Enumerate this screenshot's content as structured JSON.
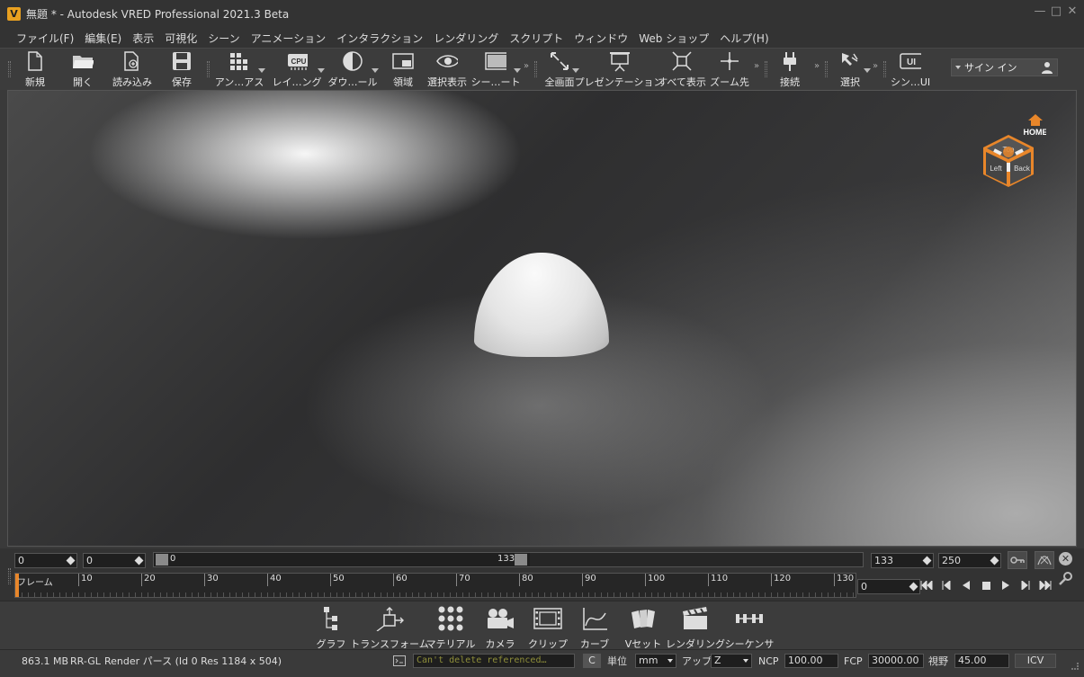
{
  "window": {
    "title": "無題 * - Autodesk VRED Professional 2021.3 Beta",
    "logo_letter": "V"
  },
  "menu": [
    "ファイル(F)",
    "編集(E)",
    "表示",
    "可視化",
    "シーン",
    "アニメーション",
    "インタラクション",
    "レンダリング",
    "スクリプト",
    "ウィンドウ",
    "Web ショップ",
    "ヘルプ(H)"
  ],
  "toolbar": {
    "new": "新規",
    "open": "開く",
    "import": "読み込み",
    "save": "保存",
    "antialias": "アン…アス",
    "raytracing": "レイ…ング",
    "download": "ダウ…ール",
    "region": "領域",
    "show_selected": "選択表示",
    "scene_plate": "シー…ート",
    "fullscreen": "全画面",
    "presentation": "プレゼンテーション",
    "show_all": "すべて表示",
    "zoom_to": "ズーム先",
    "connect": "接続",
    "select": "選択",
    "scene_ui": "シン…UI",
    "signin": "サイン イン",
    "cpu_badge": "CPU",
    "ui_badge": "UI"
  },
  "navcube": {
    "home": "HOME",
    "top": "Top",
    "left": "Left",
    "back": "Back"
  },
  "timeline": {
    "start": "0",
    "current": "0",
    "range_start": "0",
    "range_end": "133",
    "end_frame": "133",
    "total": "250",
    "frame_label": "フレーム",
    "ticks": [
      "10",
      "20",
      "30",
      "40",
      "50",
      "60",
      "70",
      "80",
      "90",
      "100",
      "110",
      "120",
      "130"
    ],
    "playback_frame": "0"
  },
  "modules": [
    "グラフ",
    "トランスフォーム",
    "マテリアル",
    "カメラ",
    "クリップ",
    "カーブ",
    "Vセット",
    "レンダリング",
    "シーケンサ"
  ],
  "status": {
    "memory": "863.1 MB",
    "renderer": "RR-GL",
    "render_info": "Render パース (Id 0 Res 1184 x 504)",
    "message": "Can't delete referenced…",
    "clear": "C",
    "unit_label": "単位",
    "unit": "mm",
    "up_label": "アップ",
    "up": "Z",
    "ncp_label": "NCP",
    "ncp": "100.00",
    "fcp_label": "FCP",
    "fcp": "30000.00",
    "fov_label": "視野",
    "fov": "45.00",
    "icv": "ICV"
  },
  "colors": {
    "accent": "#e8862a",
    "background": "#3a3a3a"
  }
}
